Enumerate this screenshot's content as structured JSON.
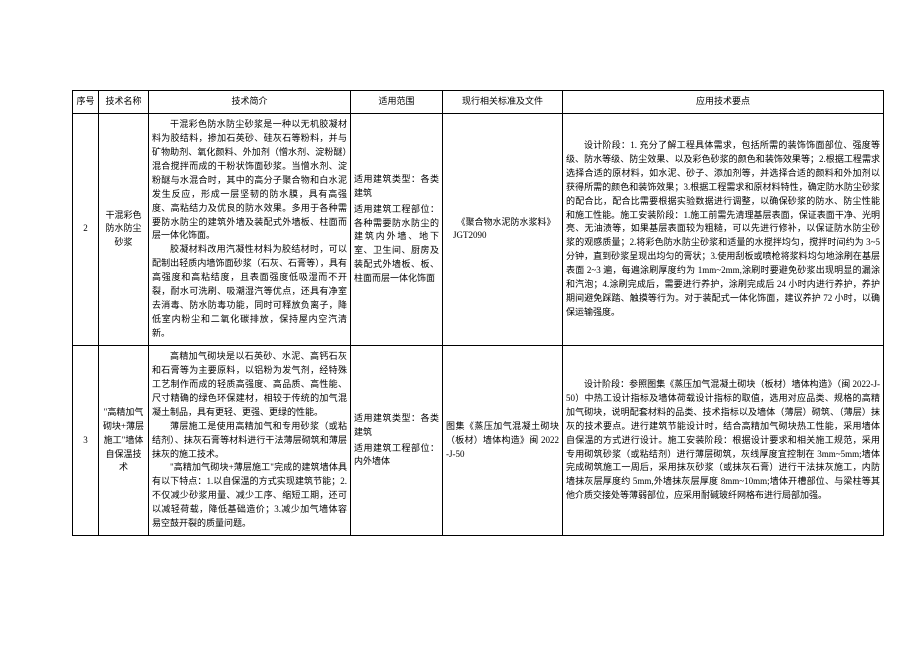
{
  "columns": {
    "seq": "序号",
    "name": "技术名称",
    "desc": "技术简介",
    "scope": "适用范围",
    "std": "现行相关标准及文件",
    "apply": "应用技术要点"
  },
  "rows": [
    {
      "seq": "2",
      "name": "干混彩色防水防尘砂浆",
      "desc_p1": "干混彩色防水防尘砂浆是一种以无机胶凝材料为胶结料，掺加石英砂、硅灰石等粉料，并与矿物助剂、氧化颜料、外加剂（憎水剂、淀粉醚）混合搅拌而成的干粉状饰面砂浆。当憎水剂、淀粉醚与水混合时，其中的高分子聚合物和白水泥发生反应，形成一层坚韧的防水膜，具有高强度、高粘结力及优良的防水效果。多用于各种需要防水防尘的建筑外墙及装配式外墙板、柱面而层一体化饰面。",
      "desc_p2": "胶凝材料改用汽凝性材料为胶结材时，可以配制出轻质内墙饰面砂浆（石灰、石膏等），具有高强度和高粘结度，且表面强度低吸湿而不开裂，耐水可洗刷、吸潮湿汽等优点，还具有净室去消毒、防水防毒功能，同时可释放负离子，降低室内粉尘和二氧化碳排放，保持屋内空汽清新。",
      "scope_type_label": "适用建筑类型：",
      "scope_type": "各类建筑",
      "scope_part_label": "适用建筑工程部位：",
      "scope_part": "各种需要防水防尘的建筑内外墙、地下室、卫生间、厨房及装配式外墙板、板、柱面而层一体化饰面",
      "std_title": "《聚合物水泥防水浆料》",
      "std_code": "JGT2090",
      "apply": "设计阶段：1. 充分了解工程具体需求，包括所需的装饰饰面部位、强度等级、防水等级、防尘效果、以及彩色砂浆的颜色和装饰效果等；2.根据工程需求选择合适的原材料，如水泥、砂子、添加剂等，并选择合适的颜料和外加剂以获得所需的颜色和装饰效果；3.根据工程需求和原材料特性，确定防水防尘砂浆的配合比，配合比需要根据实验数据进行调整，以确保砂浆的防水、防尘性能和施工性能。施工安装阶段：1.施工前需先清理基层表面，保证表面干净、光明亮、无油渍等，如果基层表面较为粗糙，可以先进行修补，以保证防水防尘砂浆的观感质量；2.将彩色防水防尘砂浆和适量的水搅拌均匀，搅拌时间约为 3~5 分钟，直到砂浆呈现出均匀的膏状；3.使用刮板或喷枪将浆料均匀地涂刷在基层表面 2~3 遍，每遍涂刷厚度约为 1mm~2mm,涂刷时要避免砂浆出现明显的漏涂和汽泡；4.涂刷完成后，需要进行养护，涂刷完成后 24 小时内进行养护，养护期间避免踩踏、触摸等行为。对于装配式一体化饰面，建议养护 72 小时，以确保运输强度。"
    },
    {
      "seq": "3",
      "name": "\"高精加气砌块+薄层施工\"墙体自保温技术",
      "desc_p1": "高精加气砌块是以石英砂、水泥、高钙石灰和石膏等为主要原料，以铝粉为发气剂，经特殊工艺制作而成的轻质高强度、高品质、高性能、尺寸精确的绿色环保建材，相较于传统的加气混凝土制品，具有更轻、更强、更绿的性能。",
      "desc_p2": "薄层施工是使用高精加气和专用砂浆（或粘结剂）、抹灰石膏等材料进行干法薄层砌筑和薄层抹灰的施工技术。",
      "desc_p3": "\"高精加气砌块+薄层施工\"完成的建筑墙体具有以下特点：1.以自保温的方式实现建筑节能；2.不仅减少砂浆用量、减少工序、缩短工期，还可以减轻荷载，降低基础造价；3.减少加气墙体容易空鼓开裂的质量问题。",
      "scope_type_label": "适用建筑类型：",
      "scope_type": "各类建筑",
      "scope_part_label": "适用建筑工程部位：",
      "scope_part": "内外墙体",
      "std_title": "图集《蒸压加气混凝土砌块（板材）墙体构造》闽 2022-J-50",
      "std_code": "",
      "apply": "设计阶段：参照图集《蒸压加气混凝土砌块（板材）墙体构造》（闽 2022-J-50）中热工设计指标及墙体荷载设计指标的取值，选用对应品类、规格的高精加气砌块，说明配套材料的品类、技术指标以及墙体（薄层）砌筑、（薄层）抹灰的技术要点。进行建筑节能设计时，结合高精加气砌块热工性能，采用墙体自保温的方式进行设计。施工安装阶段：根据设计要求和相关施工规范，采用专用砌筑砂浆（或粘结剂）进行薄层砌筑，灰线厚度宜控制在 3mm~5mm;墙体完成砌筑施工一周后，采用抹灰砂浆（或抹灰石膏）进行干法抹灰施工，内防墙抹灰层厚度约 5mm,外墙抹灰层厚度 8mm~10mm;墙体开槽部位、与梁柱等其他介质交接处等薄弱部位，应采用耐碱玻纤网格布进行局部加强。"
    }
  ]
}
